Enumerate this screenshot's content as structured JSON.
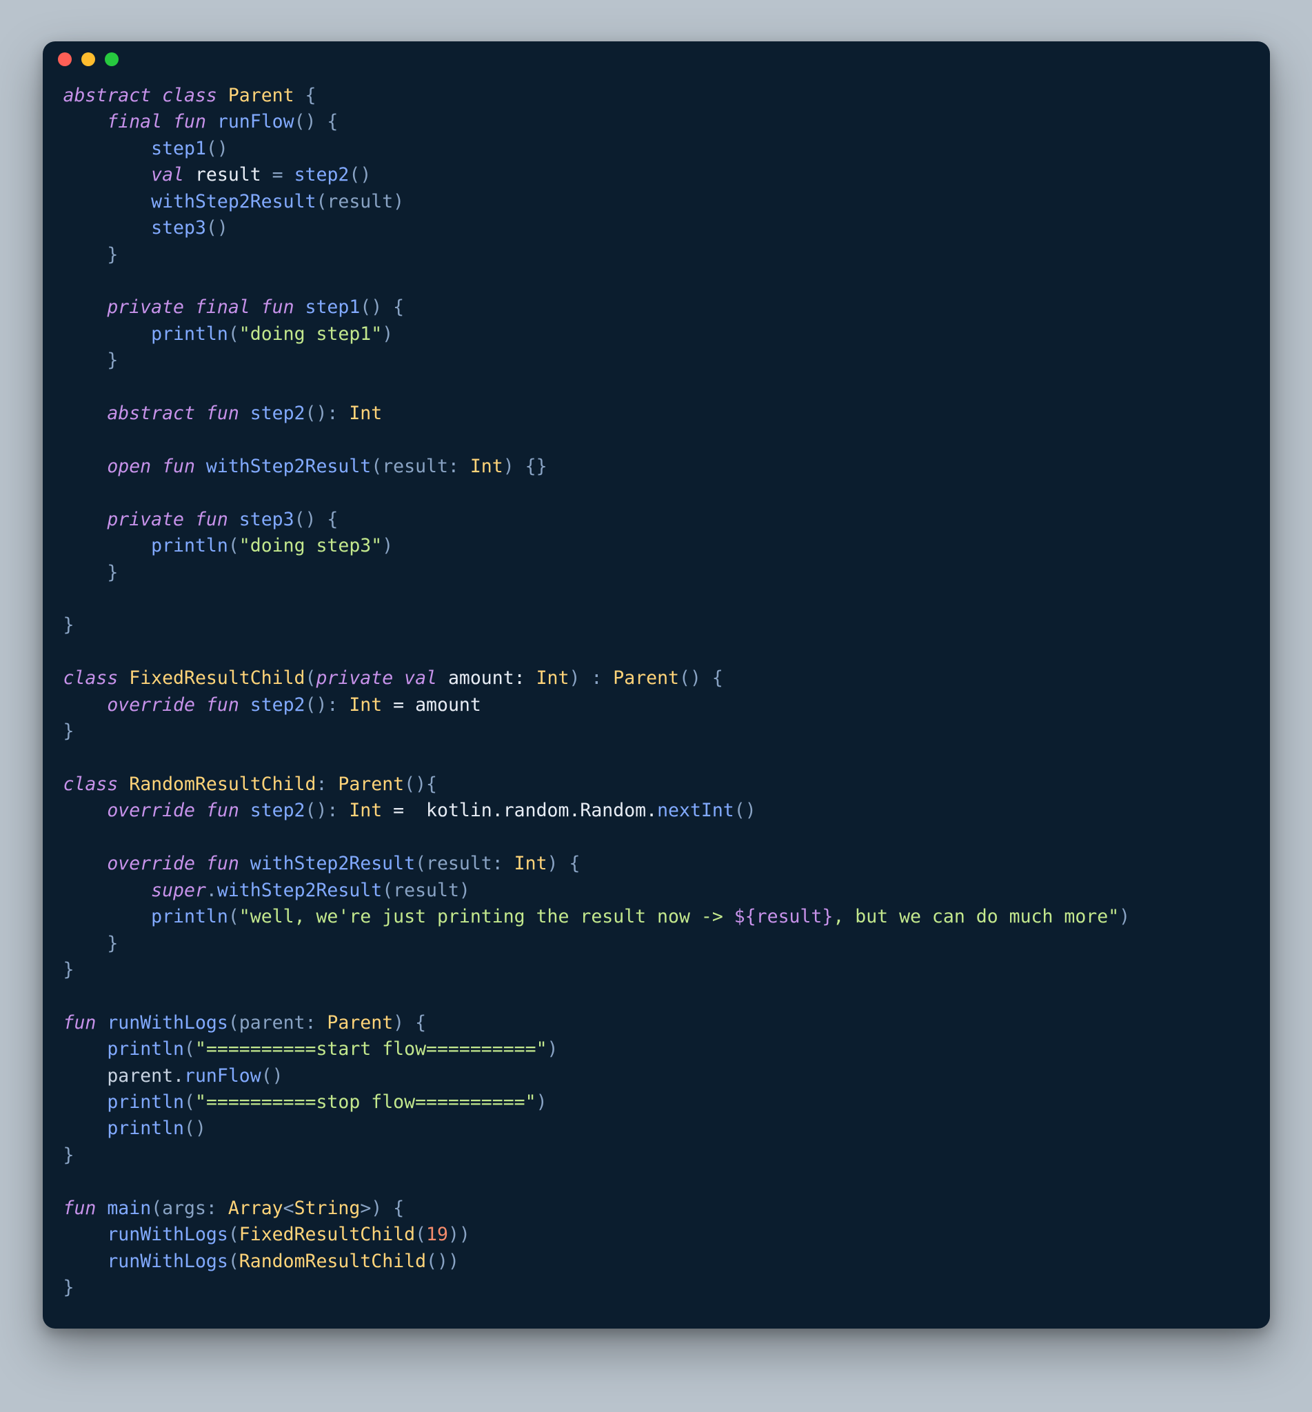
{
  "window": {
    "dots": [
      "red",
      "yellow",
      "green"
    ]
  },
  "code": {
    "L1": {
      "a": "abstract class ",
      "b": "Parent",
      "c": " {"
    },
    "L2": {
      "a": "    final fun ",
      "b": "runFlow",
      "c": "() {"
    },
    "L3": {
      "a": "        ",
      "b": "step1",
      "c": "()"
    },
    "L4": {
      "a": "        ",
      "b": "val ",
      "c": "result",
      "d": " = ",
      "e": "step2",
      "f": "()"
    },
    "L5": {
      "a": "        ",
      "b": "withStep2Result",
      "c": "(result)"
    },
    "L6": {
      "a": "        ",
      "b": "step3",
      "c": "()"
    },
    "L7": {
      "a": "    }"
    },
    "L8": {
      "a": ""
    },
    "L9": {
      "a": "    private final fun ",
      "b": "step1",
      "c": "() {"
    },
    "L10": {
      "a": "        ",
      "b": "println",
      "c": "(",
      "d": "\"doing step1\"",
      "e": ")"
    },
    "L11": {
      "a": "    }"
    },
    "L12": {
      "a": ""
    },
    "L13": {
      "a": "    abstract fun ",
      "b": "step2",
      "c": "(): ",
      "d": "Int"
    },
    "L14": {
      "a": ""
    },
    "L15": {
      "a": "    open fun ",
      "b": "withStep2Result",
      "c": "(result: ",
      "d": "Int",
      "e": ") {}"
    },
    "L16": {
      "a": ""
    },
    "L17": {
      "a": "    private fun ",
      "b": "step3",
      "c": "() {"
    },
    "L18": {
      "a": "        ",
      "b": "println",
      "c": "(",
      "d": "\"doing step3\"",
      "e": ")"
    },
    "L19": {
      "a": "    }"
    },
    "L20": {
      "a": ""
    },
    "L21": {
      "a": "}"
    },
    "L22": {
      "a": ""
    },
    "L23": {
      "a": "class ",
      "b": "FixedResultChild",
      "c": "(",
      "d": "private val ",
      "e": "amount: ",
      "f": "Int",
      "g": ") : ",
      "h": "Parent",
      "i": "() {"
    },
    "L24": {
      "a": "    override fun ",
      "b": "step2",
      "c": "(): ",
      "d": "Int",
      "e": " = amount"
    },
    "L25": {
      "a": "}"
    },
    "L26": {
      "a": ""
    },
    "L27": {
      "a": "class ",
      "b": "RandomResultChild",
      "c": ": ",
      "d": "Parent",
      "e": "(){"
    },
    "L28": {
      "a": "    override fun ",
      "b": "step2",
      "c": "(): ",
      "d": "Int",
      "e": " =  kotlin.random.Random.",
      "f": "nextInt",
      "g": "()"
    },
    "L29": {
      "a": ""
    },
    "L30": {
      "a": "    override fun ",
      "b": "withStep2Result",
      "c": "(result: ",
      "d": "Int",
      "e": ") {"
    },
    "L31": {
      "a": "        ",
      "b": "super",
      "c": ".",
      "d": "withStep2Result",
      "e": "(result)"
    },
    "L32": {
      "a": "        ",
      "b": "println",
      "c": "(",
      "d": "\"well, we're just printing the result now -> ",
      "e": "${result}",
      "f": ", but we can do much more\"",
      "g": ")"
    },
    "L33": {
      "a": "    }"
    },
    "L34": {
      "a": "}"
    },
    "L35": {
      "a": ""
    },
    "L36": {
      "a": "fun ",
      "b": "runWithLogs",
      "c": "(parent: ",
      "d": "Parent",
      "e": ") {"
    },
    "L37": {
      "a": "    ",
      "b": "println",
      "c": "(",
      "d": "\"==========start flow==========\"",
      "e": ")"
    },
    "L38": {
      "a": "    parent.",
      "b": "runFlow",
      "c": "()"
    },
    "L39": {
      "a": "    ",
      "b": "println",
      "c": "(",
      "d": "\"==========stop flow==========\"",
      "e": ")"
    },
    "L40": {
      "a": "    ",
      "b": "println",
      "c": "()"
    },
    "L41": {
      "a": "}"
    },
    "L42": {
      "a": ""
    },
    "L43": {
      "a": "fun ",
      "b": "main",
      "c": "(args: ",
      "d": "Array",
      "e": "<",
      "f": "String",
      "g": ">) {"
    },
    "L44": {
      "a": "    ",
      "b": "runWithLogs",
      "c": "(",
      "d": "FixedResultChild",
      "e": "(",
      "f": "19",
      "g": "))"
    },
    "L45": {
      "a": "    ",
      "b": "runWithLogs",
      "c": "(",
      "d": "RandomResultChild",
      "e": "())"
    },
    "L46": {
      "a": "}"
    }
  }
}
